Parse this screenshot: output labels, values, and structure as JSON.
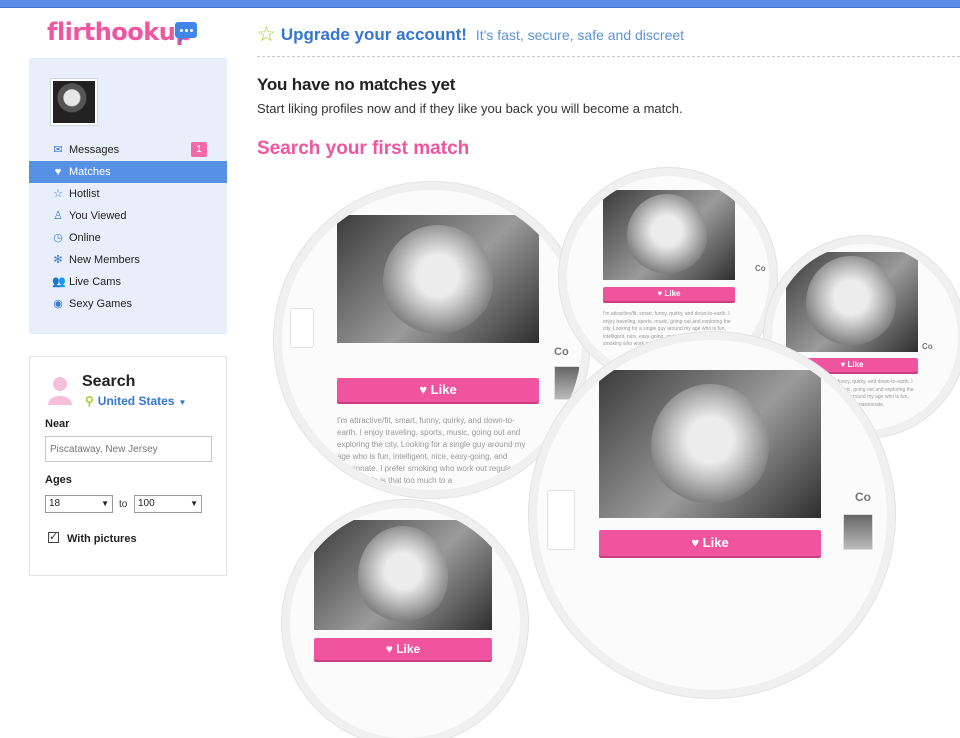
{
  "logo": {
    "text": "flirthookup"
  },
  "upgrade": {
    "title": "Upgrade your account!",
    "tagline": "It's fast, secure, safe and discreet"
  },
  "menu": [
    {
      "label": "Messages",
      "icon": "envelope-icon",
      "badge": "1"
    },
    {
      "label": "Matches",
      "icon": "heart-icon",
      "active": true
    },
    {
      "label": "Hotlist",
      "icon": "star-icon"
    },
    {
      "label": "You Viewed",
      "icon": "person-icon"
    },
    {
      "label": "Online",
      "icon": "clock-icon"
    },
    {
      "label": "New Members",
      "icon": "gear-icon"
    },
    {
      "label": "Live Cams",
      "icon": "people-icon"
    },
    {
      "label": "Sexy Games",
      "icon": "globe-icon"
    }
  ],
  "search": {
    "title": "Search",
    "country": "United States",
    "near_label": "Near",
    "near_placeholder": "Piscataway, New Jersey",
    "ages_label": "Ages",
    "age_from": "18",
    "age_to_label": "to",
    "age_to": "100",
    "with_pictures_label": "With pictures"
  },
  "main": {
    "heading": "You have no matches yet",
    "subheading": "Start liking profiles now and if they like you back you will become a match.",
    "search_first": "Search your first match"
  },
  "profiles": [
    {
      "like_label": "Like",
      "bio": "I'm attractive/fit, smart, funny, quirky, and down-to-earth. I enjoy traveling, sports, music, going out and exploring the city. Looking for a single guy around my age who is fun, intelligent, nice, easy-going, and passionate. I prefer smoking who work out regularly and kno life is that too much to a"
    },
    {
      "like_label": "Like",
      "bio": "I'm attractive/fit, smart, funny, quirky, and down-to-earth. I enjoy traveling, sports, music, going out and exploring the city. Looking for a single guy around my age who is fun, intelligent, nice, easy-going, and passionate. I prefer smoking who work out regularly and kno"
    },
    {
      "like_label": "Like",
      "bio": "I'm attractive/fit, smart, funny, quirky, and down-to-earth. I enjoy traveling, sports, music, going out and exploring the city. Looking for a single guy around my age who is fun, intelligent, nice, easy-going, and passionate."
    },
    {
      "like_label": "Like"
    },
    {
      "like_label": "Like"
    }
  ],
  "ghost_labels": {
    "co": "Co"
  },
  "colors": {
    "accent": "#f0559f",
    "brand_blue": "#3476d0",
    "menu_active": "#5791e6",
    "sidebar_bg": "#e8effa"
  }
}
